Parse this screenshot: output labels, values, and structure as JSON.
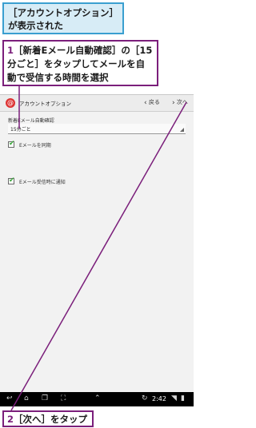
{
  "callouts": {
    "top": "［アカウントオプション］が表示された",
    "step1_number": "1",
    "step1_text": "［新着Eメール自動確認］の［15分ごと］をタップしてメールを自動で受信する時間を選択",
    "step2_number": "2",
    "step2_text": "［次へ］をタップ"
  },
  "screen": {
    "action_bar": {
      "title": "アカウントオプション",
      "back_label": "戻る",
      "next_label": "次へ"
    },
    "section_label": "新着Eメール自動確認",
    "select_value": "15分ごと",
    "checkboxes": [
      {
        "label": "Eメールを同期",
        "checked": true
      },
      {
        "label": "Eメール受信時に通知",
        "checked": true
      }
    ],
    "system_bar": {
      "time": "2:42"
    }
  },
  "colors": {
    "callout_blue_border": "#3a9fd0",
    "callout_blue_fill": "#d7ecf6",
    "callout_purple": "#7b1f7b",
    "check_green": "#3aa83a"
  }
}
